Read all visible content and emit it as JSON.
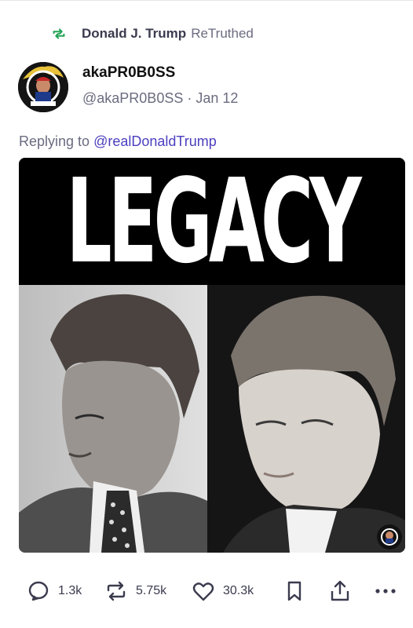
{
  "retruth": {
    "name": "Donald J. Trump",
    "label": "ReTruthed"
  },
  "post": {
    "display_name": "akaPR0B0SS",
    "handle": "@akaPR0B0SS",
    "separator": "·",
    "date": "Jan 12",
    "reply_prefix": "Replying to",
    "reply_to": "@realDonaldTrump",
    "image_headline": "LEGACY"
  },
  "actions": {
    "replies": "1.3k",
    "retruths": "5.75k",
    "likes": "30.3k"
  },
  "colors": {
    "retruth_icon": "#23a455",
    "link": "#4b3fbf",
    "muted": "#6b6b80",
    "icon": "#3b3b4f"
  },
  "icons": [
    "retruth-icon",
    "reply-icon",
    "retruth-action-icon",
    "like-icon",
    "bookmark-icon",
    "share-icon",
    "more-icon"
  ]
}
